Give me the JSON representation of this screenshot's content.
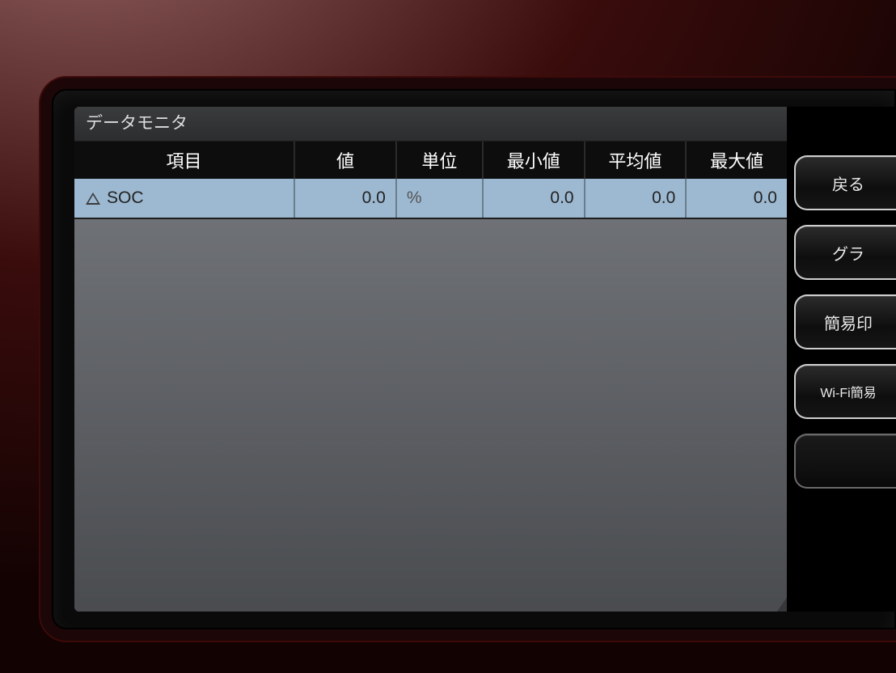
{
  "title": "データモニタ",
  "table": {
    "headers": {
      "item": "項目",
      "value": "値",
      "unit": "単位",
      "min": "最小値",
      "avg": "平均値",
      "max": "最大値"
    },
    "rows": [
      {
        "item": "SOC",
        "value": "0.0",
        "unit": "%",
        "min": "0.0",
        "avg": "0.0",
        "max": "0.0"
      }
    ]
  },
  "side_buttons": {
    "back": "戻る",
    "graph": "グラ",
    "simple_print": "簡易印",
    "wifi_print": "Wi-Fi簡易"
  }
}
